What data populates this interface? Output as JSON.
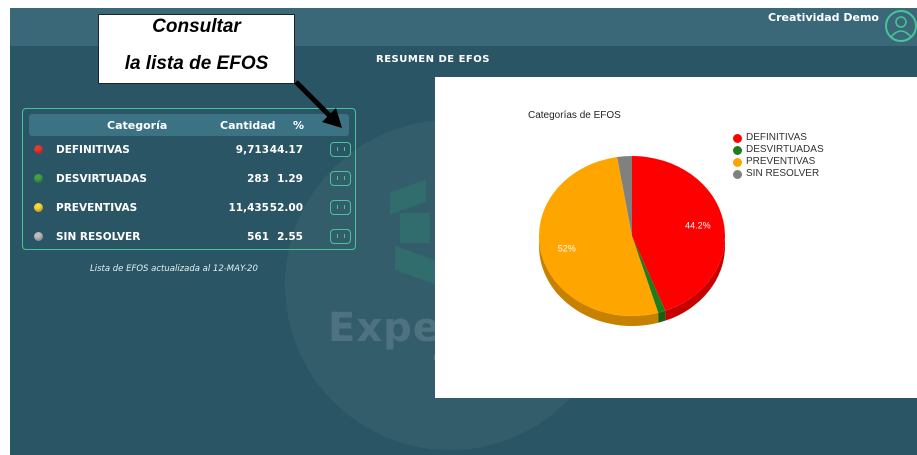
{
  "header": {
    "user_name": "Creatividad Demo",
    "page_title": "RESUMEN DE EFOS"
  },
  "callout": {
    "line1": "Consultar",
    "line2": "la lista de EFOS"
  },
  "background": {
    "brand_fragment": "Exper",
    "brand_small": "C"
  },
  "table": {
    "headers": {
      "category": "Categoría",
      "quantity": "Cantidad",
      "percent": "%"
    },
    "rows": [
      {
        "category": "DEFINITIVAS",
        "quantity": "9,713",
        "percent": "44.17",
        "color": "#e53935"
      },
      {
        "category": "DESVIRTUADAS",
        "quantity": "283",
        "percent": "1.29",
        "color": "#43a047"
      },
      {
        "category": "PREVENTIVAS",
        "quantity": "11,435",
        "percent": "52.00",
        "color": "#fdd835"
      },
      {
        "category": "SIN RESOLVER",
        "quantity": "561",
        "percent": "2.55",
        "color": "#bdbdbd"
      }
    ],
    "updated_text": "Lista de EFOS actualizada al 12-MAY-20"
  },
  "chart_data": {
    "type": "pie",
    "title": "Categorías de EFOS",
    "categories": [
      "DEFINITIVAS",
      "DESVIRTUADAS",
      "PREVENTIVAS",
      "SIN RESOLVER"
    ],
    "values": [
      44.17,
      1.29,
      52.0,
      2.55
    ],
    "colors": [
      "#ff0000",
      "#1b7d1b",
      "#ffa500",
      "#808080"
    ],
    "data_labels": [
      "44.2%",
      "",
      "52%",
      ""
    ],
    "legend_position": "top-right"
  },
  "colors": {
    "accent": "#45c59a",
    "app_bg": "#2a5565",
    "topbar": "#3b6878"
  }
}
